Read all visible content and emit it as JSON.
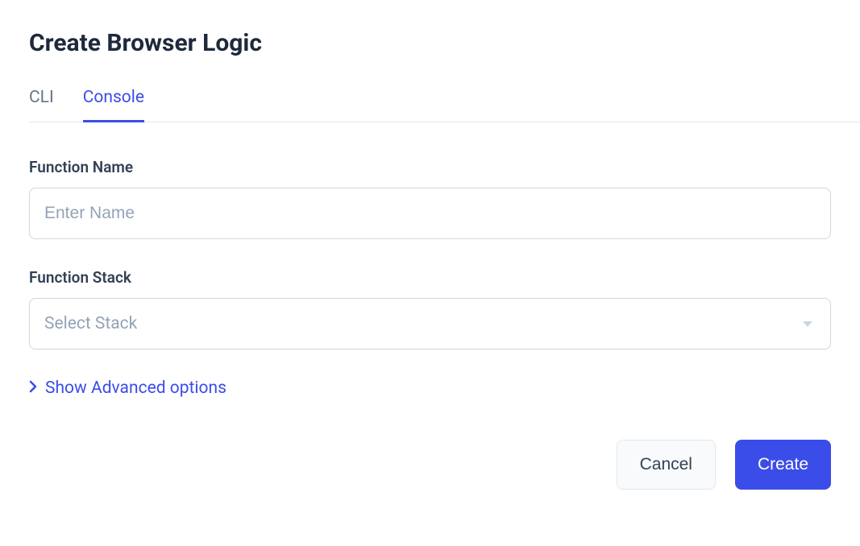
{
  "header": {
    "title": "Create Browser Logic"
  },
  "tabs": {
    "items": [
      {
        "label": "CLI",
        "active": false
      },
      {
        "label": "Console",
        "active": true
      }
    ]
  },
  "form": {
    "functionName": {
      "label": "Function Name",
      "placeholder": "Enter Name",
      "value": ""
    },
    "functionStack": {
      "label": "Function Stack",
      "placeholder": "Select Stack"
    },
    "advanced": {
      "label": "Show Advanced options"
    }
  },
  "footer": {
    "cancel": "Cancel",
    "create": "Create"
  }
}
